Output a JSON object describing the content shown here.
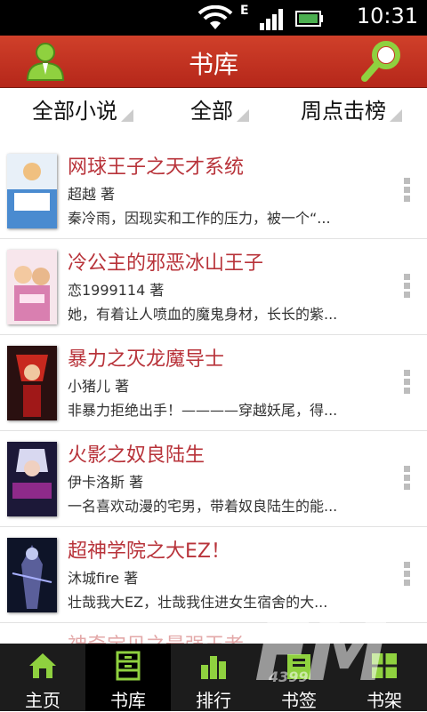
{
  "status_bar": {
    "time": "10:31",
    "network": "E"
  },
  "header": {
    "title": "书库"
  },
  "filters": [
    {
      "label": "全部小说"
    },
    {
      "label": "全部"
    },
    {
      "label": "周点击榜"
    }
  ],
  "books": [
    {
      "title": "网球王子之天才系统",
      "author": "超越 著",
      "desc": "秦冷雨，因现实和工作的压力，被一个“..."
    },
    {
      "title": "冷公主的邪恶冰山王子",
      "author": "恋1999114 著",
      "desc": "她，有着让人喷血的魔鬼身材，长长的紫..."
    },
    {
      "title": "暴力之灭龙魔导士",
      "author": "小猪儿 著",
      "desc": "非暴力拒绝出手！————穿越妖尾，得..."
    },
    {
      "title": "火影之奴良陆生",
      "author": "伊卡洛斯 著",
      "desc": "一名喜欢动漫的宅男，带着奴良陆生的能..."
    },
    {
      "title": "超神学院之大EZ！",
      "author": "沐城fire 著",
      "desc": "壮哉我大EZ，壮哉我住进女生宿舍的大..."
    }
  ],
  "partial_book": {
    "title": "神奇宝贝之最强王者"
  },
  "tabs": [
    {
      "label": "主页",
      "icon": "home-icon",
      "active": false
    },
    {
      "label": "书库",
      "icon": "library-icon",
      "active": true
    },
    {
      "label": "排行",
      "icon": "ranking-icon",
      "active": false
    },
    {
      "label": "书签",
      "icon": "bookmark-icon",
      "active": false
    },
    {
      "label": "书架",
      "icon": "bookshelf-icon",
      "active": false
    }
  ],
  "watermark": {
    "big": "FM",
    "small": "4399"
  },
  "colors": {
    "header": "#c0321f",
    "title_red": "#b8333a",
    "tabbar": "#1c1c1c"
  }
}
